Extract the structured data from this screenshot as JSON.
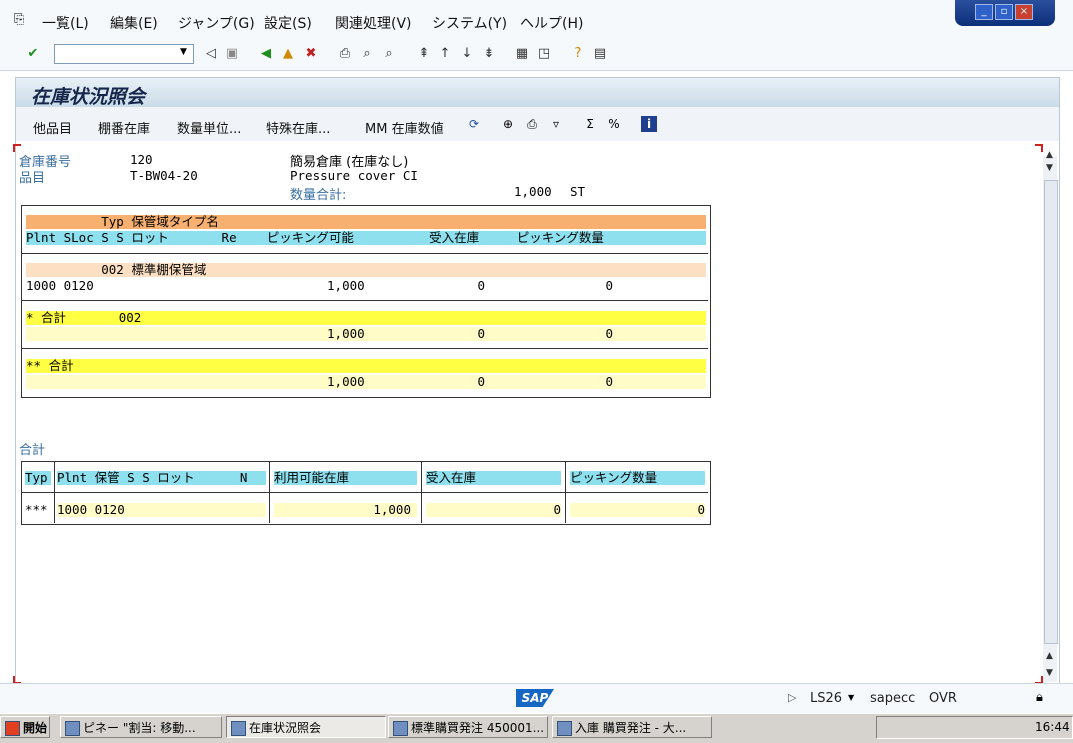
{
  "menu": {
    "items": [
      "一覧(L)",
      "編集(E)",
      "ジャンプ(G)",
      "設定(S)",
      "関連処理(V)",
      "システム(Y)",
      "ヘルプ(H)"
    ]
  },
  "window_controls": {
    "minimize": "_",
    "restore": "▫",
    "close": "×"
  },
  "toolbar": {
    "command_field_value": "",
    "icons": [
      "enter-icon",
      "back-icon",
      "save-icon",
      "back-green-icon",
      "exit-icon",
      "cancel-icon",
      "print-icon",
      "find-icon",
      "find-next-icon",
      "first-page-icon",
      "prev-page-icon",
      "next-page-icon",
      "last-page-icon",
      "create-session-icon",
      "shortcut-icon",
      "help-icon",
      "layout-icon"
    ]
  },
  "title": "在庫状況照会",
  "app_toolbar": {
    "buttons": [
      "他品目",
      "棚番在庫",
      "数量単位...",
      "特殊在庫...",
      "MM 在庫数値"
    ]
  },
  "header": {
    "warehouse_label": "倉庫番号",
    "warehouse_value": "120",
    "warehouse_desc": "簡易倉庫 (在庫なし)",
    "material_label": "品目",
    "material_value": "T-BW04-20",
    "material_desc": "Pressure cover CI",
    "total_qty_label": "数量合計:",
    "total_qty_value": "1,000",
    "total_qty_unit": "ST"
  },
  "list": {
    "header1": "          Typ 保管域タイプ名",
    "header2": "Plnt SLoc S S ロット       Re    ピッキング可能          受入在庫     ピッキング数量",
    "group_line": "          002 標準棚保管域",
    "detail_line": "1000 0120                               1,000               0                0",
    "subtotal_label": "* 合計       002",
    "subtotal_values": "                                        1,000               0                0",
    "total_label": "** 合計",
    "total_values": "                                        1,000               0                0"
  },
  "summary": {
    "label": "合計",
    "headers": [
      "Typ",
      "Plnt 保管 S S ロット      N",
      "利用可能在庫",
      "受入在庫",
      "ピッキング数量"
    ],
    "row": [
      "***",
      "1000 0120",
      "1,000",
      "0",
      "0"
    ]
  },
  "status": {
    "sap_logo": "SAP",
    "transaction": "LS26",
    "server": "sapecc",
    "mode": "OVR"
  },
  "taskbar": {
    "start": "開始",
    "tasks": [
      "ピネー \"割当: 移動...",
      "在庫状況照会",
      "標準購買発注 450001...",
      "入庫 購買発注 - 大..."
    ],
    "tray_time": "16:44"
  }
}
